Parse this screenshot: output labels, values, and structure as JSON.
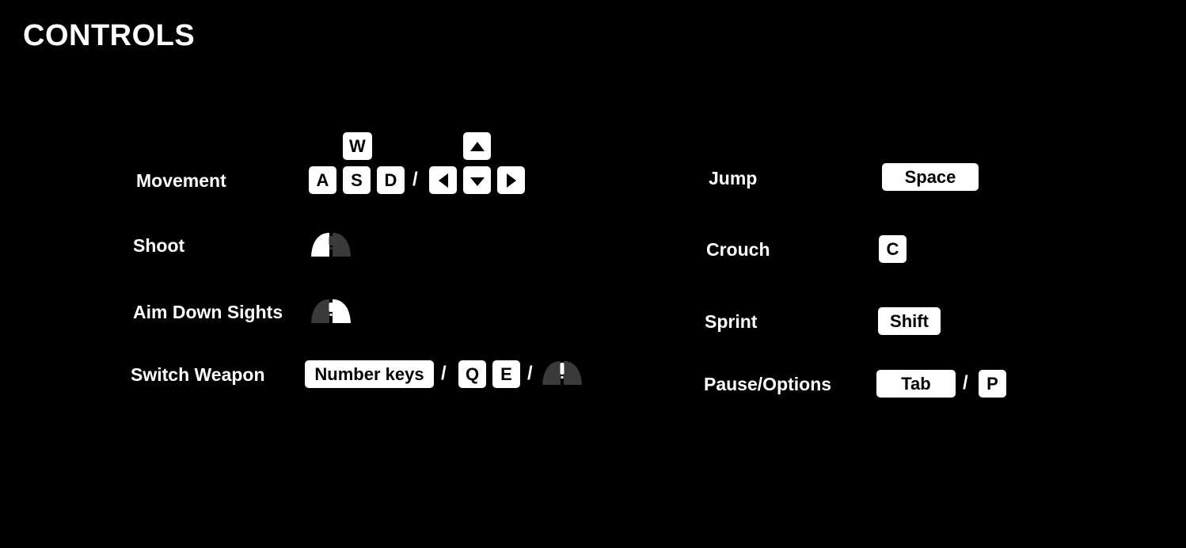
{
  "title": "CONTROLS",
  "colors": {
    "background": "#000000",
    "text": "#ffffff",
    "key_bg": "#ffffff",
    "key_text": "#000000",
    "mouse_dim": "#3a3a3a"
  },
  "left": {
    "movement": {
      "label": "Movement",
      "keys": [
        "W",
        "A",
        "S",
        "D"
      ],
      "separator": "/",
      "arrows": [
        "arrow-up-icon",
        "arrow-left-icon",
        "arrow-down-icon",
        "arrow-right-icon"
      ]
    },
    "shoot": {
      "label": "Shoot",
      "icon": "mouse-left-click-icon"
    },
    "aim": {
      "label": "Aim Down Sights",
      "icon": "mouse-right-click-icon"
    },
    "switch_weapon": {
      "label": "Switch Weapon",
      "keys": [
        "Number keys",
        "Q",
        "E"
      ],
      "separators": [
        "/",
        "/"
      ],
      "icon": "mouse-scroll-icon"
    }
  },
  "right": {
    "jump": {
      "label": "Jump",
      "key": "Space"
    },
    "crouch": {
      "label": "Crouch",
      "key": "C"
    },
    "sprint": {
      "label": "Sprint",
      "key": "Shift"
    },
    "pause": {
      "label": "Pause/Options",
      "keys": [
        "Tab",
        "P"
      ],
      "separator": "/"
    }
  }
}
